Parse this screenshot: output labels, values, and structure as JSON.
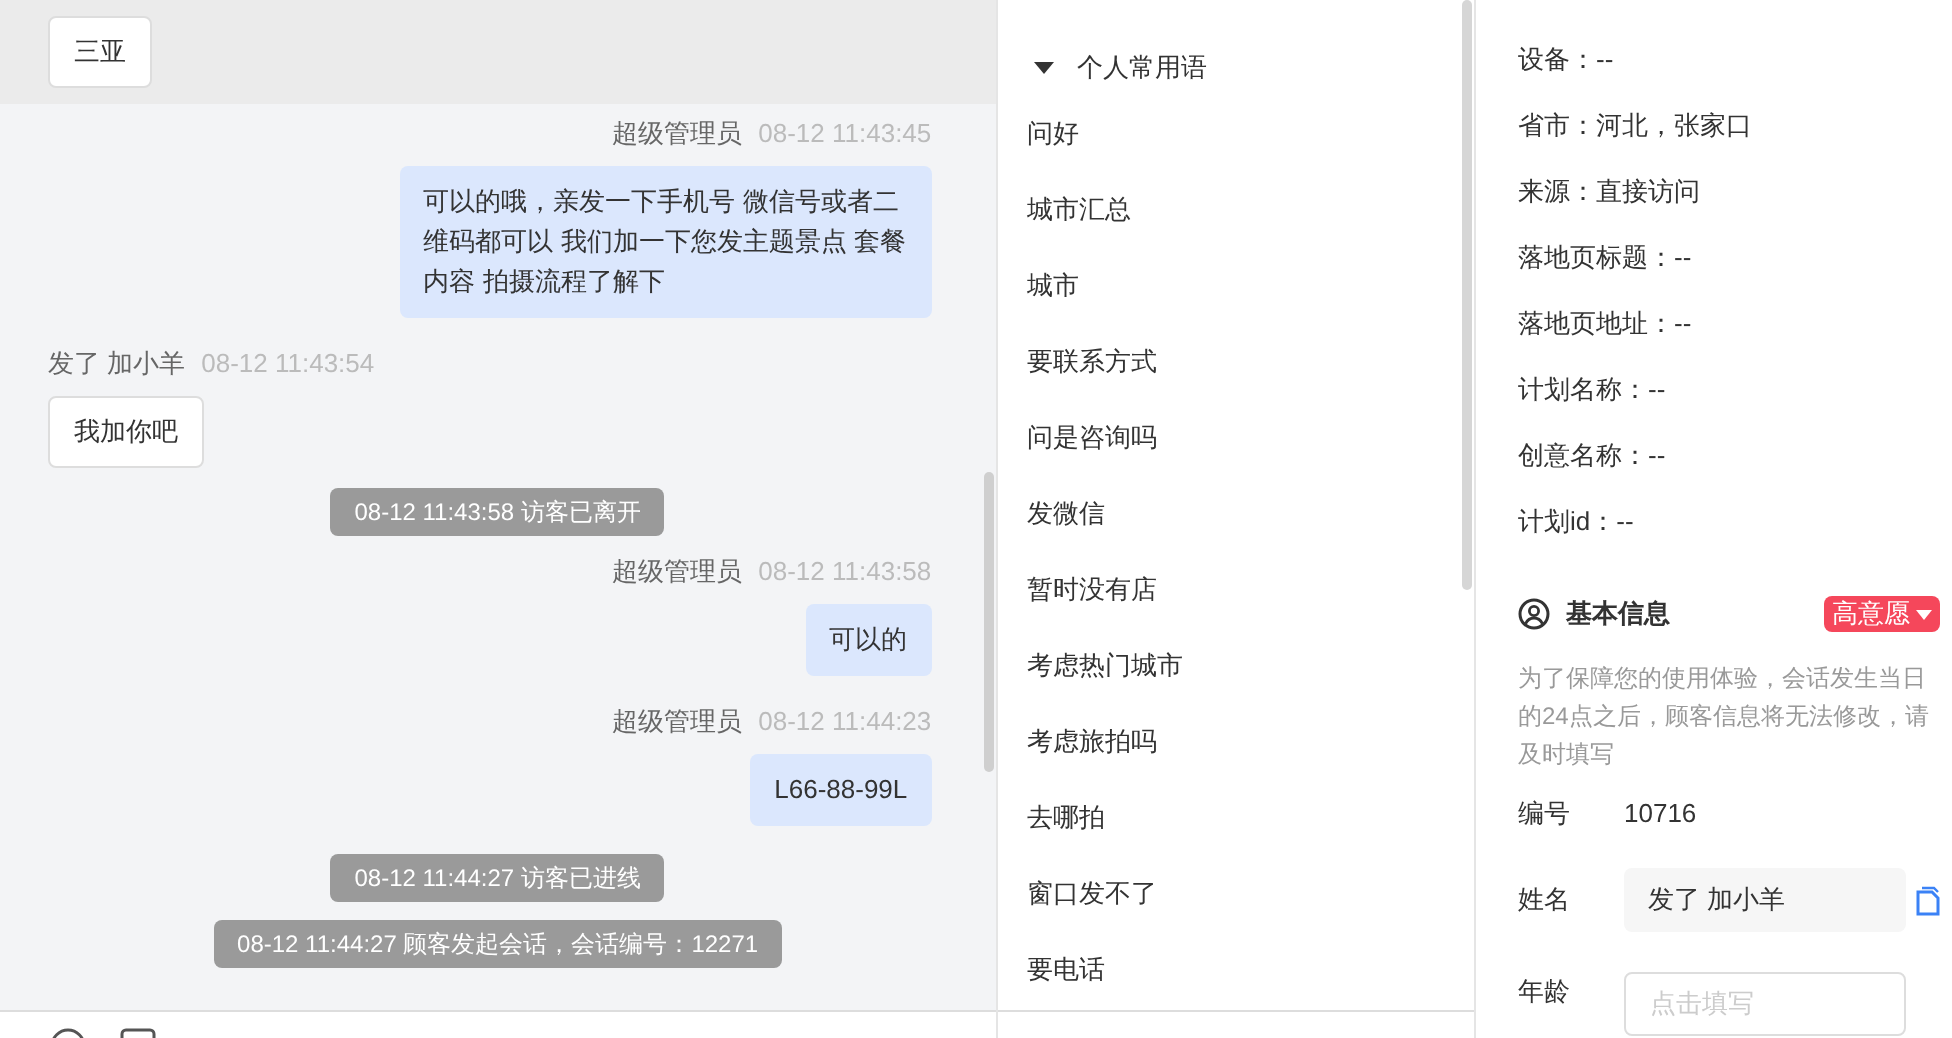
{
  "chat": {
    "top_bubble": "三亚",
    "messages": [
      {
        "kind": "agent",
        "sender": "超级管理员",
        "time": "08-12 11:43:45",
        "text": "可以的哦，亲发一下手机号 微信号或者二维码都可以 我们加一下您发主题景点 套餐内容 拍摄流程了解下"
      },
      {
        "kind": "visitor",
        "sender": "发了 加小羊",
        "time": "08-12 11:43:54",
        "text": "我加你吧"
      },
      {
        "kind": "system",
        "text": "08-12 11:43:58 访客已离开"
      },
      {
        "kind": "agent",
        "sender": "超级管理员",
        "time": "08-12 11:43:58",
        "text": "可以的"
      },
      {
        "kind": "agent",
        "sender": "超级管理员",
        "time": "08-12 11:44:23",
        "text": "L66-88-99L"
      },
      {
        "kind": "system",
        "text": "08-12 11:44:27 访客已进线"
      },
      {
        "kind": "system",
        "text": "08-12 11:44:27 顾客发起会话，会话编号：12271"
      }
    ]
  },
  "phrases": {
    "group": {
      "label": "个人常用语",
      "expanded": true
    },
    "items": [
      "问好",
      "城市汇总",
      "城市",
      "要联系方式",
      "问是咨询吗",
      "发微信",
      "暂时没有店",
      "考虑热门城市",
      "考虑旅拍吗",
      "去哪拍",
      "窗口发不了",
      "要电话"
    ]
  },
  "visitor_info": [
    "设备：--",
    "省市：河北，张家口",
    "来源：直接访问",
    "落地页标题：--",
    "落地页地址：--",
    "计划名称：--",
    "创意名称：--",
    "计划id：--"
  ],
  "basic_info": {
    "title": "基本信息",
    "intent_tag": "高意愿",
    "note": "为了保障您的使用体验，会话发生当日的24点之后，顾客信息将无法修改，请及时填写",
    "fields": [
      {
        "kind": "text",
        "label": "编号",
        "value": "10716"
      },
      {
        "kind": "input",
        "label": "姓名",
        "value": "发了 加小羊"
      },
      {
        "kind": "empty",
        "label": "年龄",
        "placeholder": "点击填写"
      }
    ]
  }
}
